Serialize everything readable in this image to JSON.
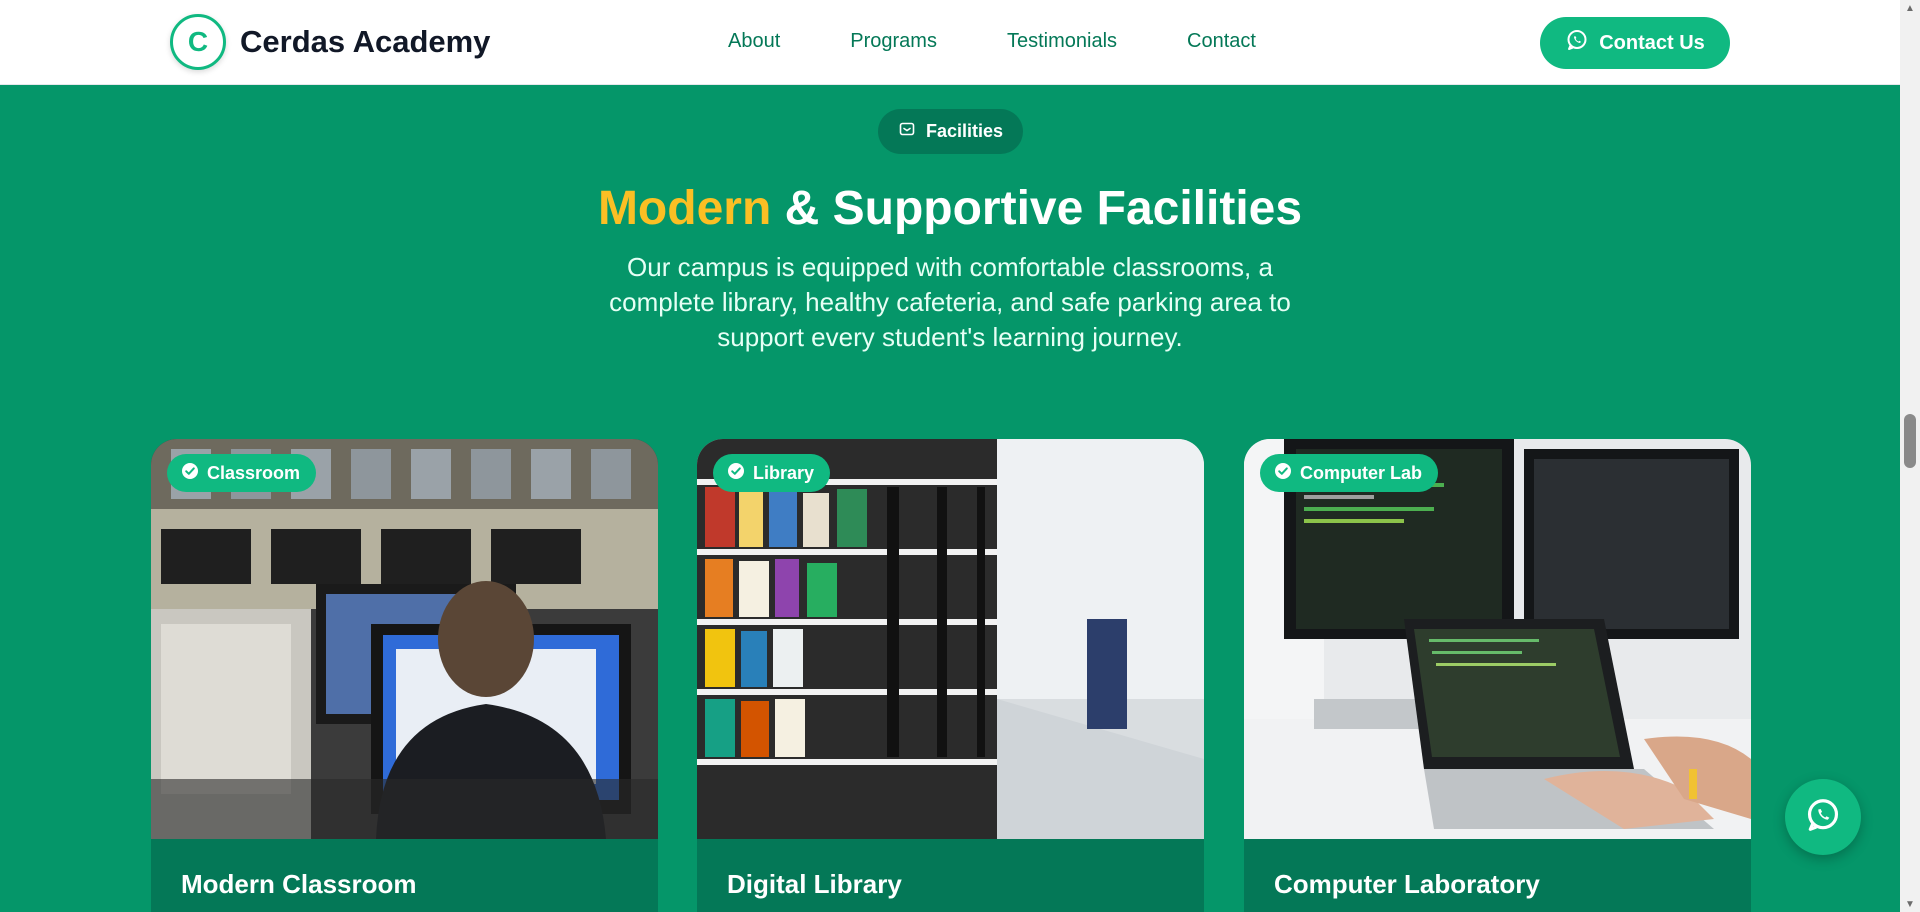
{
  "header": {
    "logo_letter": "C",
    "brand_name": "Cerdas Academy",
    "nav": [
      "About",
      "Programs",
      "Testimonials",
      "Contact"
    ],
    "cta_label": "Contact Us",
    "cta_icon": "whatsapp-icon"
  },
  "section": {
    "pill_label": "Facilities",
    "pill_icon": "building-icon",
    "heading_accent": "Modern",
    "heading_rest": "& Supportive Facilities",
    "subtitle": "Our campus is equipped with comfortable classrooms, a complete library, healthy cafeteria, and safe parking area to support every student's learning journey.",
    "cards": [
      {
        "badge": "Classroom",
        "title": "Modern Classroom"
      },
      {
        "badge": "Library",
        "title": "Digital Library"
      },
      {
        "badge": "Computer Lab",
        "title": "Computer Laboratory"
      }
    ]
  },
  "colors": {
    "primary": "#059669",
    "primary_dark": "#047857",
    "button": "#10b981",
    "accent": "#fbbf24",
    "nav_text": "#047857"
  },
  "floating_button_icon": "whatsapp-icon"
}
